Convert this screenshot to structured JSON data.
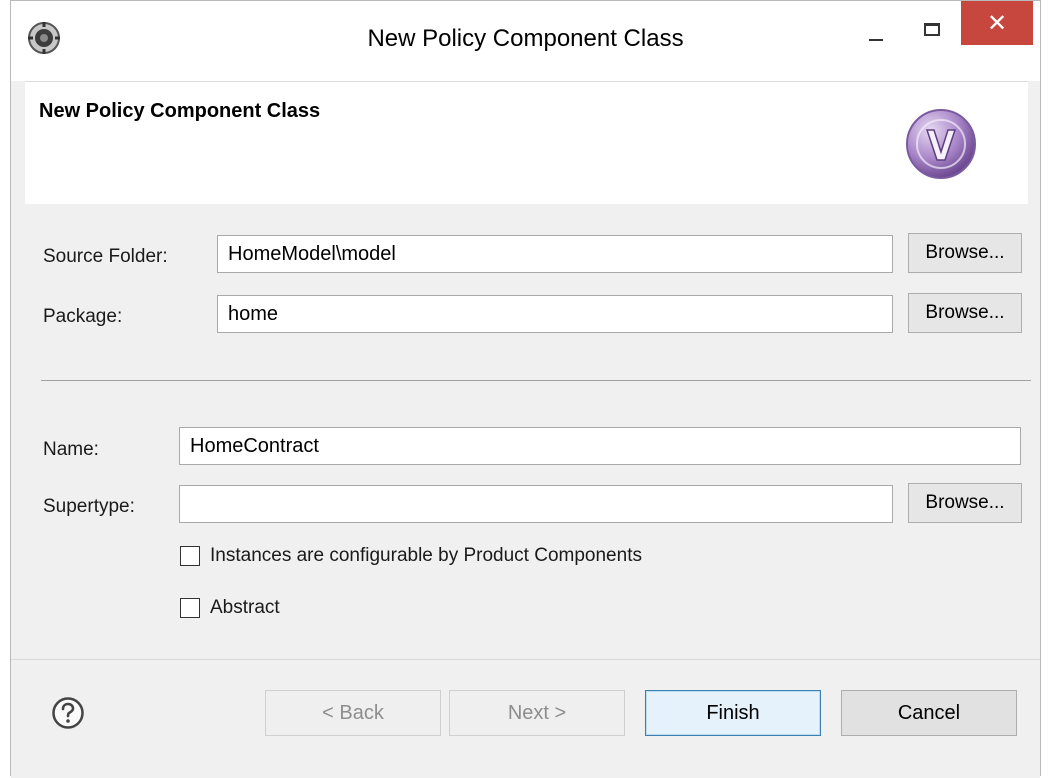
{
  "window": {
    "title": "New Policy Component Class",
    "close_glyph": "✕",
    "app_icon": "eclipse-gear-icon"
  },
  "header": {
    "title": "New Policy Component Class",
    "logo_icon": "faktorips-v-logo-icon",
    "logo_letter": "V",
    "logo_color": "#8f6bb0"
  },
  "form": {
    "source_folder": {
      "label": "Source Folder:",
      "value": "HomeModel\\model",
      "browse_label": "Browse..."
    },
    "package": {
      "label": "Package:",
      "value": "home",
      "browse_label": "Browse..."
    },
    "name": {
      "label": "Name:",
      "value": "HomeContract"
    },
    "supertype": {
      "label": "Supertype:",
      "value": "",
      "browse_label": "Browse..."
    },
    "configurable_checkbox": {
      "label": "Instances are configurable by Product Components",
      "checked": false
    },
    "abstract_checkbox": {
      "label": "Abstract",
      "checked": false
    }
  },
  "footer": {
    "help_icon": "help-question-icon",
    "back_label": "< Back",
    "next_label": "Next >",
    "finish_label": "Finish",
    "cancel_label": "Cancel"
  }
}
